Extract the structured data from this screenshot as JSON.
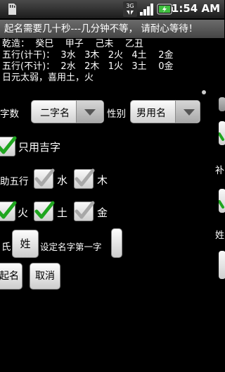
{
  "status": {
    "time": "1:54 AM",
    "network": "3G"
  },
  "title": "起名需要几十秒---几分钟不等， 请耐心等待！",
  "info": {
    "bazi": "乾造：  癸巳    甲子    己未    乙丑",
    "wuxing_with_gan": "五行(计干)：  3水   3木   2火   4土    2金",
    "wuxing_without_gan": "五行(不计)：  2水   2木   1火   3土    0金",
    "rizhu": "日元太弱，喜用土，火"
  },
  "form": {
    "name_length_label": "字数",
    "name_length_value": "二字名",
    "gender_label": "性别",
    "gender_value": "男用名",
    "auspicious_only_label": "只用吉字",
    "auspicious_only_checked": true,
    "helper_label": "助五行",
    "elements": [
      {
        "label": "水",
        "checked": false
      },
      {
        "label": "木",
        "checked": false
      },
      {
        "label": "火",
        "checked": true
      },
      {
        "label": "土",
        "checked": true
      },
      {
        "label": "金",
        "checked": false
      }
    ],
    "surname_label": "氏",
    "surname_button": "姓",
    "first_char_label": "设定名字第一字",
    "generate_button": "起名",
    "cancel_button": "取消"
  },
  "right_edge": {
    "label_bu": "补",
    "label_xing": "姓"
  }
}
